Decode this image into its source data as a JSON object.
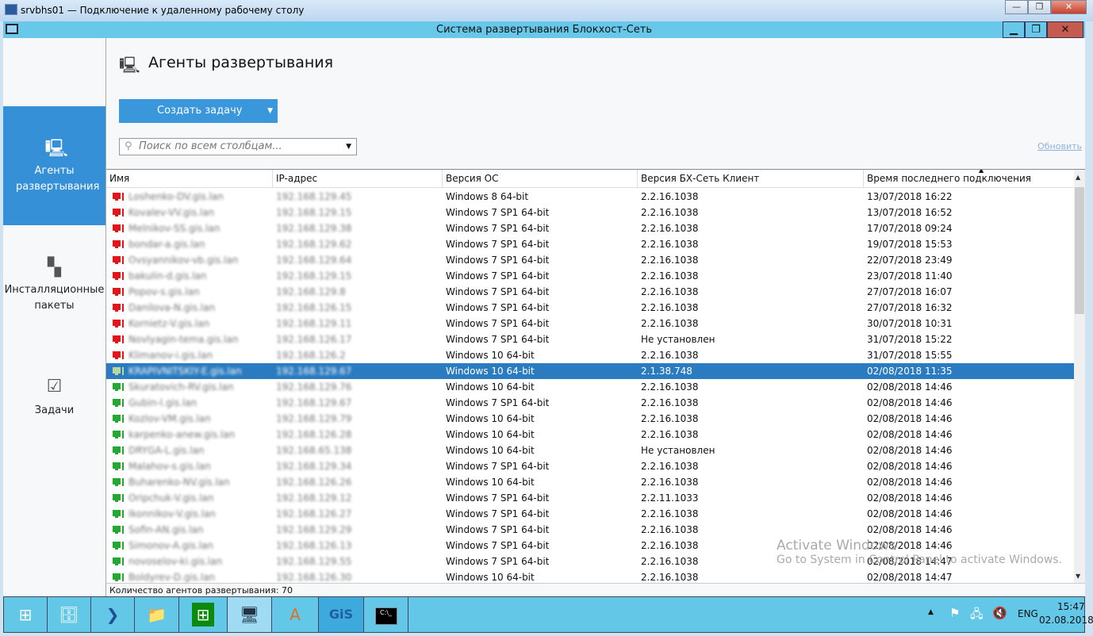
{
  "rdp": {
    "title": "srvbhs01 — Подключение к удаленному рабочему столу"
  },
  "app": {
    "title": "Система развертывания Блокхост-Сеть"
  },
  "sidebar": {
    "items": [
      {
        "label": "Агенты развертывания",
        "icon": "monitors-icon",
        "active": true
      },
      {
        "label": "Инсталляционные пакеты",
        "icon": "packages-icon"
      },
      {
        "label": "Задачи",
        "icon": "checkbox-icon"
      }
    ]
  },
  "header": {
    "title": "Агенты развертывания",
    "create_label": "Создать задачу",
    "search_placeholder": "Поиск по всем столбцам...",
    "refresh_label": "Обновить"
  },
  "table": {
    "columns": [
      "Имя",
      "IP-адрес",
      "Версия ОС",
      "Версия БХ-Сеть Клиент",
      "Время последнего подключения"
    ],
    "sorted_column": 4,
    "rows": [
      [
        "Loshenko-DV.gis.lan",
        "192.168.129.45",
        "Windows 8 64-bit",
        "2.2.16.1038",
        "13/07/2018 16:22",
        "offline"
      ],
      [
        "Kovalev-VV.gis.lan",
        "192.168.129.15",
        "Windows 7 SP1 64-bit",
        "2.2.16.1038",
        "13/07/2018 16:52",
        "offline"
      ],
      [
        "Melnikov-SS.gis.lan",
        "192.168.129.38",
        "Windows 7 SP1 64-bit",
        "2.2.16.1038",
        "17/07/2018 09:24",
        "offline"
      ],
      [
        "bondar-a.gis.lan",
        "192.168.129.62",
        "Windows 7 SP1 64-bit",
        "2.2.16.1038",
        "19/07/2018 15:53",
        "offline"
      ],
      [
        "Ovsyannikov-vb.gis.lan",
        "192.168.129.64",
        "Windows 7 SP1 64-bit",
        "2.2.16.1038",
        "22/07/2018 23:49",
        "offline"
      ],
      [
        "bakulin-d.gis.lan",
        "192.168.129.15",
        "Windows 7 SP1 64-bit",
        "2.2.16.1038",
        "23/07/2018 11:40",
        "offline"
      ],
      [
        "Popov-s.gis.lan",
        "192.168.129.8",
        "Windows 7 SP1 64-bit",
        "2.2.16.1038",
        "27/07/2018 16:07",
        "offline"
      ],
      [
        "Danilova-N.gis.lan",
        "192.168.126.15",
        "Windows 7 SP1 64-bit",
        "2.2.16.1038",
        "27/07/2018 16:32",
        "offline"
      ],
      [
        "Kornietz-V.gis.lan",
        "192.168.129.11",
        "Windows 7 SP1 64-bit",
        "2.2.16.1038",
        "30/07/2018 10:31",
        "offline"
      ],
      [
        "Novlyagin-tema.gis.lan",
        "192.168.126.17",
        "Windows 7 SP1 64-bit",
        "Не установлен",
        "31/07/2018 15:22",
        "offline"
      ],
      [
        "Klimanov-i.gis.lan",
        "192.168.126.2",
        "Windows 10 64-bit",
        "2.2.16.1038",
        "31/07/2018 15:55",
        "offline"
      ],
      [
        "KRAPIVNITSKIY-E.gis.lan",
        "192.168.129.67",
        "Windows 10 64-bit",
        "2.1.38.748",
        "02/08/2018 11:35",
        "selected"
      ],
      [
        "Skuratovich-RV.gis.lan",
        "192.168.129.76",
        "Windows 10 64-bit",
        "2.2.16.1038",
        "02/08/2018 14:46",
        "online"
      ],
      [
        "Gubin-l.gis.lan",
        "192.168.129.67",
        "Windows 7 SP1 64-bit",
        "2.2.16.1038",
        "02/08/2018 14:46",
        "online"
      ],
      [
        "Kozlov-VM.gis.lan",
        "192.168.129.79",
        "Windows 10 64-bit",
        "2.2.16.1038",
        "02/08/2018 14:46",
        "online"
      ],
      [
        "karpenko-anew.gis.lan",
        "192.168.126.28",
        "Windows 10 64-bit",
        "2.2.16.1038",
        "02/08/2018 14:46",
        "online"
      ],
      [
        "DRYGA-L.gis.lan",
        "192.168.65.138",
        "Windows 10 64-bit",
        "Не установлен",
        "02/08/2018 14:46",
        "online"
      ],
      [
        "Malahov-s.gis.lan",
        "192.168.129.34",
        "Windows 7 SP1 64-bit",
        "2.2.16.1038",
        "02/08/2018 14:46",
        "online"
      ],
      [
        "Buharenko-NV.gis.lan",
        "192.168.126.26",
        "Windows 10 64-bit",
        "2.2.16.1038",
        "02/08/2018 14:46",
        "online"
      ],
      [
        "Oripchuk-V.gis.lan",
        "192.168.129.12",
        "Windows 7 SP1 64-bit",
        "2.2.11.1033",
        "02/08/2018 14:46",
        "online"
      ],
      [
        "Ikonnikov-V.gis.lan",
        "192.168.126.27",
        "Windows 7 SP1 64-bit",
        "2.2.16.1038",
        "02/08/2018 14:46",
        "online"
      ],
      [
        "Sofin-AN.gis.lan",
        "192.168.129.29",
        "Windows 7 SP1 64-bit",
        "2.2.16.1038",
        "02/08/2018 14:46",
        "online"
      ],
      [
        "Simonov-A.gis.lan",
        "192.168.126.13",
        "Windows 7 SP1 64-bit",
        "2.2.16.1038",
        "02/08/2018 14:46",
        "online"
      ],
      [
        "novoselov-ki.gis.lan",
        "192.168.129.55",
        "Windows 7 SP1 64-bit",
        "2.2.16.1038",
        "02/08/2018 14:47",
        "online"
      ],
      [
        "Boldyrev-D.gis.lan",
        "192.168.126.30",
        "Windows 10 64-bit",
        "2.2.16.1038",
        "02/08/2018 14:47",
        "online"
      ]
    ]
  },
  "status": {
    "count_text": "Количество агентов развертывания: 70"
  },
  "watermark": {
    "line1": "Activate Windows",
    "line2": "Go to System in Control Panel to activate Windows."
  },
  "colors": {
    "offline": "#e0161b",
    "online": "#25a82f",
    "selected_icon": "#b8d79a",
    "accent": "#3a97dc",
    "selection": "#2a7bbf"
  },
  "taskbar": {
    "items": [
      "start",
      "server-manager",
      "powershell",
      "file-explorer",
      "store",
      "remote-desktop",
      "wordpad",
      "gis",
      "cmd"
    ],
    "lang": "ENG",
    "time": "15:47",
    "date": "02.08.2018"
  }
}
